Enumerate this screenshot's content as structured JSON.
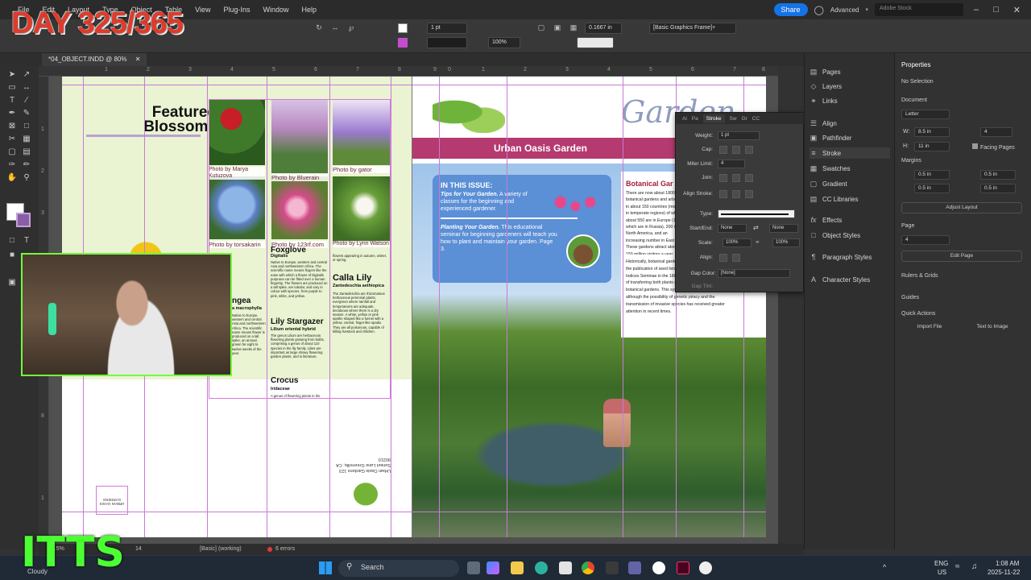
{
  "menubar": {
    "items": [
      "File",
      "Edit",
      "Layout",
      "Type",
      "Object",
      "Table",
      "View",
      "Plug-Ins",
      "Window",
      "Help"
    ],
    "share_label": "Share",
    "workspace_label": "Advanced",
    "stock_placeholder": "Adobe Stock"
  },
  "control": {
    "stroke_weight": "1 pt",
    "scale_value": "100%",
    "scale_value_2": "100%",
    "gutter_value": "0.1667 in",
    "object_style": "[Basic Graphics Frame]+"
  },
  "document": {
    "tab_title": "*04_OBJECT.INDD @ 80%",
    "zoom": "79.5%",
    "page_number": "14",
    "preflight_profile": "[Basic] (working)",
    "errors": "6 errors"
  },
  "rulers": {
    "top": [
      "1",
      "2",
      "3",
      "4",
      "5",
      "6",
      "7",
      "8",
      "9",
      "0",
      "1",
      "2",
      "3",
      "4",
      "5",
      "6",
      "7",
      "8"
    ],
    "left": [
      "1",
      "2",
      "3",
      "4",
      "5",
      "6",
      "7",
      "8",
      "9",
      "1"
    ]
  },
  "left_page": {
    "heading_line1": "Featured",
    "heading_line2": "Blossoms",
    "captions": [
      "Photo by Marya Kutuzova",
      "Photo by Bluerain",
      "Photo by gator",
      "Photo by torsakarin",
      "Photo by 123rf.com",
      "Photo by Lynn Watson"
    ],
    "col1_title": "ngea",
    "col1_sub": "a macrophylla",
    "col1_text": "Native to Europe, western and central Asia and northwestern Africa. The scientific name means flower is produced on a tall spike, an annual, grown for eight to twelve weeks of the year.",
    "col2_title": "Foxglove",
    "col2_sub": "Digitalis",
    "col2_text": "Native to Europe, western and central Asia and northwestern Africa. The scientific name means fingers like the ease with which a flower of Digitalis purpurea can be fitted over a human fingertip. The flowers are produced on a tall spike, are tubular, and vary in colour with species, from purple to pink, white, and yellow.",
    "col2b_title": "Lily Stargazer",
    "col2b_sub": "Lilium oriental hybrid",
    "col2b_text": "The genus Lilium are herbaceous flowering plants growing from bulbs, comprising a genus of about 110 species in the lily family. Lilies are important as large showy flowering garden plants, and in literature.",
    "col2c_title": "Crocus",
    "col2c_sub": "Iridaceae",
    "col2c_text": "A genus of flowering plants in the",
    "col3_title": "Calla Lily",
    "col3_sub": "Zantedeschia aethiopica",
    "col3_text": "The Zantedeschia are rhizomatous herbaceous perennial plants, evergreen where rainfall and temperatures are adequate, deciduous where there is a dry season. A white, yellow or pink spathe shaped like a funnel with a yellow, central, finger-like spadix. They are all poisonous, capable of killing livestock and children.",
    "col3_top": "flowers appearing in autumn, winter, or spring.",
    "address": "Urban Oasis Gardens 123 Sunset Lane Greenville, CA 90210",
    "mini_label": "URBAN OASIS GARDENS"
  },
  "right_page": {
    "banner_title": "Urban Oasis Garden",
    "masthead_partial": "Garden",
    "issue_heading": "IN THIS ISSUE:",
    "tips_title": "Tips for Your Garden.",
    "tips_text": "A variety of classes for the beginning and experienced gardener.",
    "planting_title": "Planting Your Garden.",
    "planting_text": "This educational seminar for beginning gardeners will teach you how to plant and maintain your garden. Page 3.",
    "botanical_title": "Botanical Gar",
    "botanical_text1": "There are now about 1800 botanical gardens and arboreta in about 150 countries (mostly in temperate regions) of which about 550 are in Europe (150 of which are in Russia), 200 in North America, and an increasing number in East Asia. These gardens attract about 150 million visitors a year, so it is not surprising that many people gain an introduction to the wonders of the plant world.",
    "botanical_text2": "Historically, botanical gardens exchanged plants through the publication of seed lists (these were called Latin: Indices Seminae in the 18th century). This was a means of transferring both plants and information between botanical gardens. This system continues today, although the possibility of genetic piracy and the transmission of invasive species has received greater attention in recent times."
  },
  "stroke_panel": {
    "tabs": [
      "Al",
      "Pa",
      "Stroke",
      "Sw",
      "Gr",
      "CC"
    ],
    "weight_label": "Weight:",
    "weight_value": "1 pt",
    "cap_label": "Cap:",
    "miter_label": "Miter Limit:",
    "miter_value": "4",
    "join_label": "Join:",
    "align_label": "Align Stroke:",
    "type_label": "Type:",
    "start_end_label": "Start/End:",
    "start_value": "None",
    "end_value": "None",
    "scale_label": "Scale:",
    "scale_start": "100%",
    "scale_end": "100%",
    "align_label2": "Align:",
    "gap_color_label": "Gap Color:",
    "gap_color_value": "[None]",
    "gap_tint_label": "Gap Tint:"
  },
  "panels": {
    "items": [
      {
        "label": "Pages",
        "icon": "pages-icon"
      },
      {
        "label": "Layers",
        "icon": "layers-icon"
      },
      {
        "label": "Links",
        "icon": "links-icon"
      },
      {
        "label": "Align",
        "icon": "align-icon"
      },
      {
        "label": "Pathfinder",
        "icon": "pathfinder-icon"
      },
      {
        "label": "Stroke",
        "icon": "stroke-icon"
      },
      {
        "label": "Swatches",
        "icon": "swatches-icon"
      },
      {
        "label": "Gradient",
        "icon": "gradient-icon"
      },
      {
        "label": "CC Libraries",
        "icon": "cc-libraries-icon"
      },
      {
        "label": "Effects",
        "icon": "effects-icon"
      },
      {
        "label": "Object Styles",
        "icon": "object-styles-icon"
      },
      {
        "label": "Paragraph Styles",
        "icon": "paragraph-styles-icon"
      },
      {
        "label": "Character Styles",
        "icon": "character-styles-icon"
      }
    ]
  },
  "properties": {
    "title": "Properties",
    "selection": "No Selection",
    "document_label": "Document",
    "page_size": "Letter",
    "width_label": "W:",
    "width_value": "8.5 in",
    "height_label": "H:",
    "height_value": "11 in",
    "pages_value": "4",
    "facing_pages": "Facing Pages",
    "margins_label": "Margins",
    "margin_top": "0.5 in",
    "margin_bottom": "0.5 in",
    "margin_left": "0.5 in",
    "margin_right": "0.5 in",
    "adjust_layout": "Adjust Layout",
    "page_label": "Page",
    "page_value": "4",
    "edit_page": "Edit Page",
    "rulers_grids": "Rulers & Grids",
    "guides": "Guides",
    "quick_actions": "Quick Actions",
    "import_file": "Import File",
    "text_to_image": "Text to Image"
  },
  "taskbar": {
    "search_label": "Search",
    "weather": "Cloudy",
    "language_top": "ENG",
    "language_bottom": "US",
    "time": "1:08 AM",
    "date": "2025-11-22"
  },
  "overlays": {
    "day_counter": "DAY 325/365",
    "brand": "ITTS"
  },
  "colors": {
    "accent_blue": "#1473e6",
    "banner_magenta": "#b43a6f",
    "info_box_blue": "#5b8fd6",
    "botanical_red": "#a61e3c",
    "day_counter_red": "#e23a2a",
    "itts_green": "#4cff33"
  }
}
